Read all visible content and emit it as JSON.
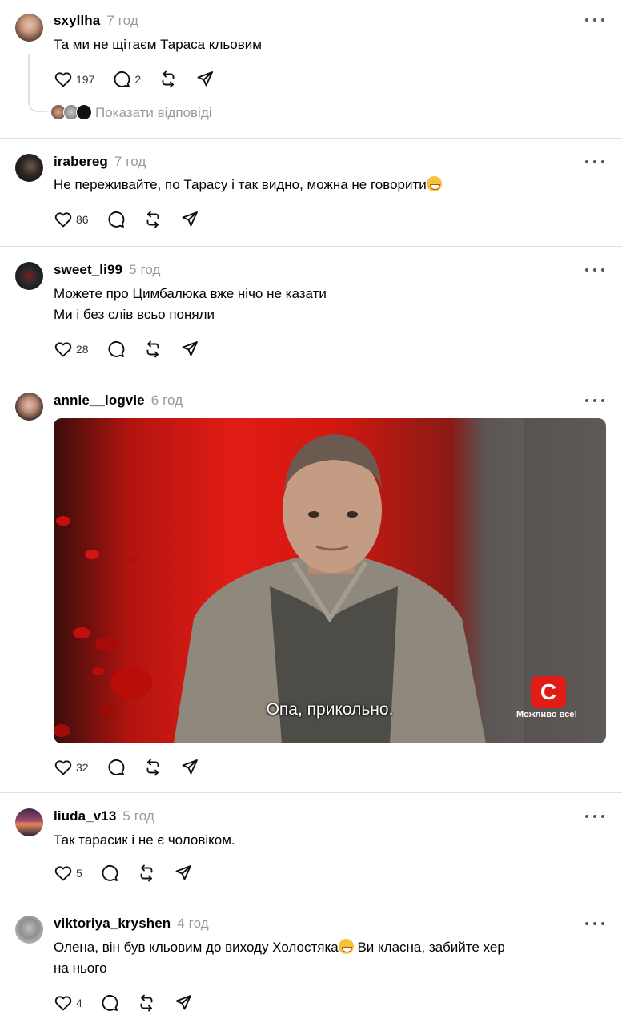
{
  "posts": [
    {
      "username": "sxyllha",
      "time": "7 год",
      "text": "Та ми не щітаєм Тараса кльовим",
      "likes": "197",
      "comments": "2",
      "show_replies": "Показати відповіді"
    },
    {
      "username": "irabereg",
      "time": "7 год",
      "text": "Не переживайте, по Тарасу і так видно, можна не говорити",
      "likes": "86"
    },
    {
      "username": "sweet_li99",
      "time": "5 год",
      "text_line1": "Можете про Цимбалюка вже нічо не казати",
      "text_line2": "Ми і без слів всьо поняли",
      "likes": "28"
    },
    {
      "username": "annie__logvie",
      "time": "6 год",
      "media": {
        "caption": "Опа, прикольно.",
        "channel_logo": "С",
        "channel_slogan": "Можливо все!"
      },
      "likes": "32"
    },
    {
      "username": "liuda_v13",
      "time": "5 год",
      "text": "Так тарасик і не є чоловіком.",
      "likes": "5"
    },
    {
      "username": "viktoriya_kryshen",
      "time": "4 год",
      "text_part1": "Олена, він був кльовим до виходу Холостяка",
      "text_part2": " Ви класна, забийте хер",
      "text_line2": "на нього",
      "likes": "4"
    }
  ],
  "icons": {
    "like": "heart-icon",
    "comment": "comment-icon",
    "repost": "repost-icon",
    "share": "share-icon",
    "more": "more-icon"
  },
  "colors": {
    "text": "#000000",
    "muted": "#9a9a9a",
    "separator": "#e0e0e0"
  }
}
